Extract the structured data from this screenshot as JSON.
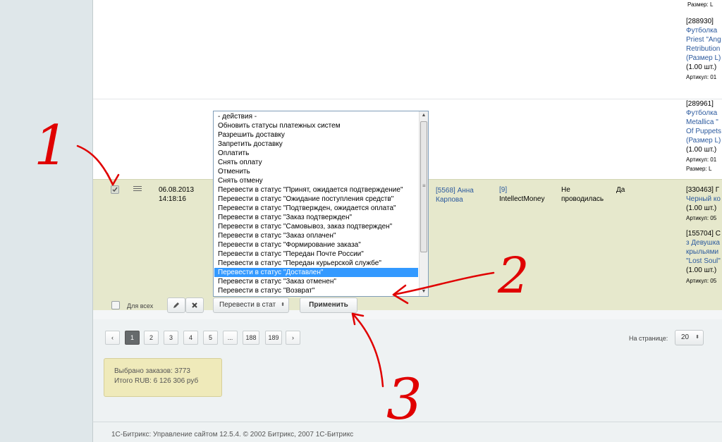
{
  "order_row": {
    "date": "06.08.2013",
    "time": "14:18:16",
    "buyer": "[5568] Анна Карпова",
    "payment": "[9] IntellectMoney",
    "payment_id": "[9]",
    "payment_name": "IntellectMoney",
    "status_line1": "Не",
    "status_line2": "проводилась",
    "flag": "Да"
  },
  "products_right": [
    {
      "line": "Размер: L"
    },
    {
      "line": "[288930]"
    },
    {
      "line": "Футболка"
    },
    {
      "line": "Priest \"Ang"
    },
    {
      "line": "Retribution"
    },
    {
      "line": "(Размер L)"
    },
    {
      "line": "(1.00 шт.)"
    },
    {
      "line": "Артикул: 01"
    },
    {
      "line": "[289961]"
    },
    {
      "line": "Футболка"
    },
    {
      "line": "Metallica \""
    },
    {
      "line": "Of Puppets"
    },
    {
      "line": "(Размер L)"
    },
    {
      "line": "(1.00 шт.)"
    },
    {
      "line": "Артикул: 01"
    },
    {
      "line": "Размер: L"
    },
    {
      "line": "[330463] Г"
    },
    {
      "line": "Черный ко"
    },
    {
      "line": "(1.00 шт.)"
    },
    {
      "line": "Артикул: 05"
    },
    {
      "line": "[155704] С"
    },
    {
      "line": "з Девушка"
    },
    {
      "line": "крыльями"
    },
    {
      "line": "\"Lost Soul\""
    },
    {
      "line": "(1.00 шт.)"
    },
    {
      "line": "Артикул: 05"
    }
  ],
  "dropdown": {
    "items": [
      "- действия -",
      "Обновить статусы платежных систем",
      "Разрешить доставку",
      "Запретить доставку",
      "Оплатить",
      "Снять оплату",
      "Отменить",
      "Снять отмену",
      "Перевести в статус \"Принят, ожидается подтверждение\"",
      "Перевести в статус \"Ожидание поступления средств\"",
      "Перевести в статус \"Подтвержден, ожидается оплата\"",
      "Перевести в статус \"Заказ подтвержден\"",
      "Перевести в статус \"Самовывоз, заказ подтвержден\"",
      "Перевести в статус \"Заказ оплачен\"",
      "Перевести в статус \"Формирование заказа\"",
      "Перевести в статус \"Передан Почте России\"",
      "Перевести в статус \"Передан курьерской службе\"",
      "Перевести в статус \"Доставлен\"",
      "Перевести в статус \"Заказ отменен\"",
      "Перевести в статус \"Возврат\""
    ],
    "selected_index": 17
  },
  "action_bar": {
    "for_all_label": "Для всех",
    "select_value": "Перевести в стат",
    "apply_label": "Применить"
  },
  "pagination": {
    "prev": "‹",
    "pages": [
      "1",
      "2",
      "3",
      "4",
      "5",
      "...",
      "188",
      "189"
    ],
    "current": "1",
    "next": "›",
    "per_page_label": "На странице:",
    "per_page_value": "20"
  },
  "summary": {
    "selected": "Выбрано заказов: 3773",
    "total": "Итого RUB: 6 126 306 руб"
  },
  "footer": {
    "text": "1С-Битрикс: Управление сайтом 12.5.4. © 2002 Битрикс, 2007 1С-Битрикс"
  },
  "annotations": {
    "one": "1",
    "two": "2",
    "three": "3"
  },
  "colors": {
    "selected_row": "#e6e8cc",
    "highlight": "#3399ff",
    "annotation": "#e00000",
    "link": "#2c5a9e"
  }
}
